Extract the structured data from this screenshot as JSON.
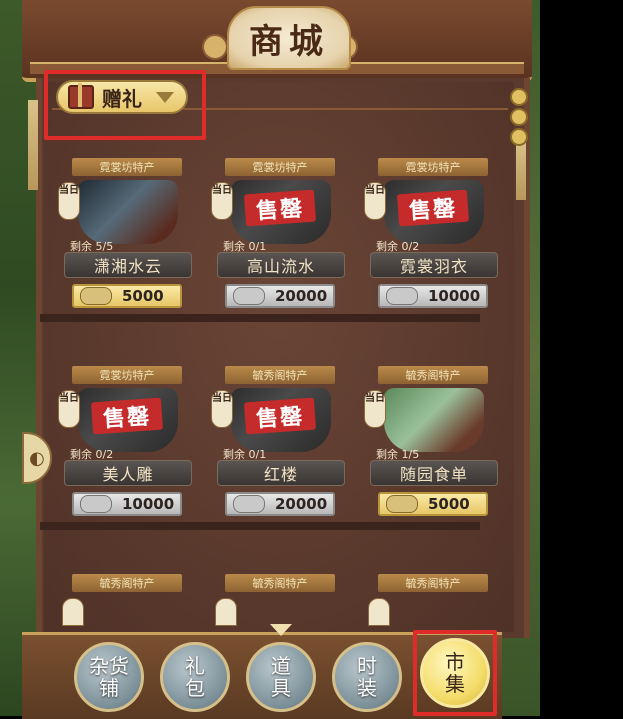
{
  "shop": {
    "title": "商城"
  },
  "filter": {
    "label": "赠礼"
  },
  "items": [
    {
      "banner": "霓裳坊特产",
      "tag": "当日",
      "remain": "剩余 5/5",
      "name": "潇湘水云",
      "price": "5000",
      "soldout": false,
      "sold_label": ""
    },
    {
      "banner": "霓裳坊特产",
      "tag": "当日",
      "remain": "剩余 0/1",
      "name": "高山流水",
      "price": "20000",
      "soldout": true,
      "sold_label": "售罄"
    },
    {
      "banner": "霓裳坊特产",
      "tag": "当日",
      "remain": "剩余 0/2",
      "name": "霓裳羽衣",
      "price": "10000",
      "soldout": true,
      "sold_label": "售罄"
    },
    {
      "banner": "霓裳坊特产",
      "tag": "当日",
      "remain": "剩余 0/2",
      "name": "美人雕",
      "price": "10000",
      "soldout": true,
      "sold_label": "售罄"
    },
    {
      "banner": "毓秀阁特产",
      "tag": "当日",
      "remain": "剩余 0/1",
      "name": "红楼",
      "price": "20000",
      "soldout": true,
      "sold_label": "售罄"
    },
    {
      "banner": "毓秀阁特产",
      "tag": "当日",
      "remain": "剩余 1/5",
      "name": "随园食单",
      "price": "5000",
      "soldout": false,
      "sold_label": ""
    }
  ],
  "row3_banners": [
    "毓秀阁特产",
    "毓秀阁特产",
    "毓秀阁特产"
  ],
  "nav": [
    {
      "line1": "杂货",
      "line2": "铺"
    },
    {
      "line1": "礼",
      "line2": "包"
    },
    {
      "line1": "道",
      "line2": "具"
    },
    {
      "line1": "时",
      "line2": "装"
    },
    {
      "line1": "市",
      "line2": "集"
    }
  ]
}
